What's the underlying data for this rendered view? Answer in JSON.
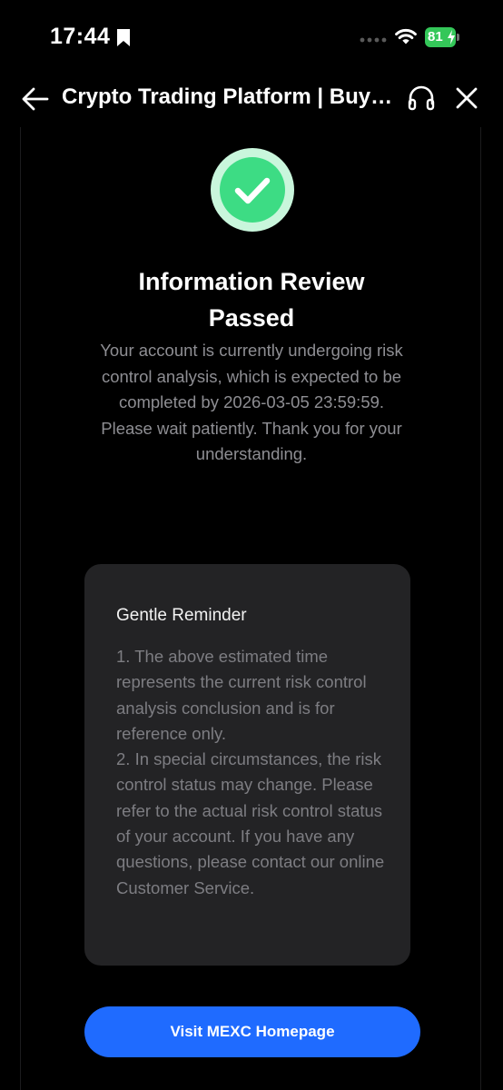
{
  "status_bar": {
    "time": "17:44",
    "battery_level": "81",
    "battery_color": "#34c759"
  },
  "nav": {
    "title": "Crypto Trading Platform | Buy Bitcoin",
    "back_icon": "arrow-left-icon",
    "support_icon": "headset-icon",
    "close_icon": "close-icon"
  },
  "result": {
    "icon": "check-circle-icon",
    "icon_color": "#3ddc84",
    "title_line1": "Information Review",
    "title_line2": "Passed",
    "desc_lines": [
      "Your account is currently undergoing risk control analysis, which is expected to be completed by 2026-03-05 23:59:59.",
      "Please wait patiently. Thank you for your understanding."
    ]
  },
  "reminder": {
    "title": "Gentle Reminder",
    "items": [
      "1. The above estimated time represents the current risk control analysis conclusion and is for reference only.",
      "2. In special circumstances, the risk control status may change. Please refer to the actual risk control status of your account. If you have any questions, please contact our online Customer Service."
    ]
  },
  "actions": {
    "primary_label": "Visit MEXC Homepage",
    "primary_color": "#1f6bff"
  }
}
